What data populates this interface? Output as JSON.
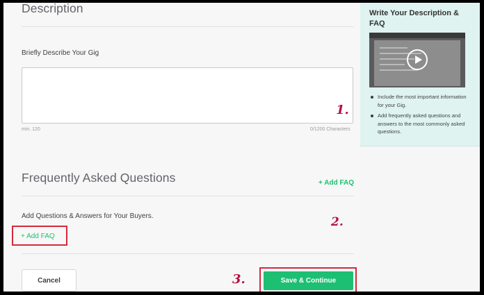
{
  "description": {
    "heading": "Description",
    "field_label": "Briefly Describe Your Gig",
    "min_text": "min. 120",
    "char_count": "0/1200 Characters",
    "value": ""
  },
  "faq": {
    "heading": "Frequently Asked Questions",
    "add_label_top": "+ Add FAQ",
    "subtitle": "Add Questions & Answers for Your Buyers.",
    "add_label_bottom": "+ Add FAQ"
  },
  "actions": {
    "cancel_label": "Cancel",
    "save_label": "Save & Continue"
  },
  "annotations": {
    "step1": "1.",
    "step2": "2.",
    "step3": "3."
  },
  "sidebar": {
    "title": "Write Your Description & FAQ",
    "bullets": [
      "Include the most important information for your Gig.",
      "Add frequently asked questions and answers to the most commonly asked questions."
    ]
  },
  "colors": {
    "brand_green": "#1dbf73",
    "annotation_red": "#d42a3a",
    "sidebar_bg": "#dff3f1"
  }
}
